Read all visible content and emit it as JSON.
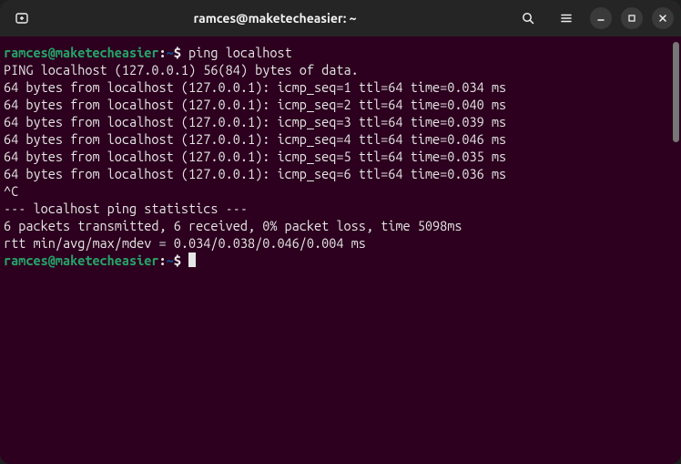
{
  "window_title": "ramces@maketecheasier: ~",
  "prompt": {
    "user_host": "ramces@maketecheasier",
    "path": "~",
    "symbol": "$"
  },
  "command": "ping localhost",
  "output": {
    "header": "PING localhost (127.0.0.1) 56(84) bytes of data.",
    "replies": [
      "64 bytes from localhost (127.0.0.1): icmp_seq=1 ttl=64 time=0.034 ms",
      "64 bytes from localhost (127.0.0.1): icmp_seq=2 ttl=64 time=0.040 ms",
      "64 bytes from localhost (127.0.0.1): icmp_seq=3 ttl=64 time=0.039 ms",
      "64 bytes from localhost (127.0.0.1): icmp_seq=4 ttl=64 time=0.046 ms",
      "64 bytes from localhost (127.0.0.1): icmp_seq=5 ttl=64 time=0.035 ms",
      "64 bytes from localhost (127.0.0.1): icmp_seq=6 ttl=64 time=0.036 ms"
    ],
    "interrupt": "^C",
    "stats_header": "--- localhost ping statistics ---",
    "stats_summary": "6 packets transmitted, 6 received, 0% packet loss, time 5098ms",
    "stats_rtt": "rtt min/avg/max/mdev = 0.034/0.038/0.046/0.004 ms"
  }
}
